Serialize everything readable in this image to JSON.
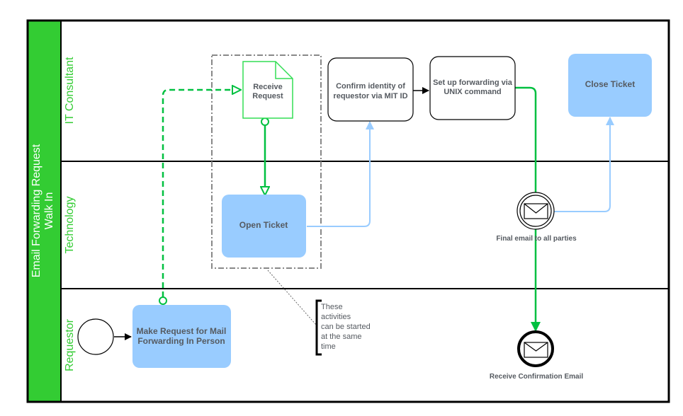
{
  "pool": {
    "title_line1": "Email Forwarding Request",
    "title_line2": "Walk In"
  },
  "lanes": [
    {
      "id": "it-consultant",
      "label": "IT Consultant"
    },
    {
      "id": "technology",
      "label": "Technology"
    },
    {
      "id": "requestor",
      "label": "Requestor"
    }
  ],
  "tasks": {
    "receive_request": {
      "line1": "Receive",
      "line2": "Request",
      "type": "document"
    },
    "confirm_identity": {
      "line1": "Confirm identity of",
      "line2": "requestor via MIT ID"
    },
    "setup_forwarding": {
      "line1": "Set up forwarding via",
      "line2": "UNIX command"
    },
    "close_ticket": {
      "label": "Close Ticket"
    },
    "open_ticket": {
      "label": "Open Ticket"
    },
    "make_request": {
      "line1": "Make Request for Mail",
      "line2": "Forwarding In Person"
    }
  },
  "events": {
    "start": {
      "label": ""
    },
    "final_email": {
      "label": "Final email to all parties",
      "icon": "envelope-icon",
      "type": "intermediate-message"
    },
    "receive_confirmation": {
      "label": "Receive Confirmation Email",
      "icon": "envelope-icon",
      "type": "end-message"
    }
  },
  "annotation": {
    "lines": [
      "These",
      "activities",
      "can be started",
      "at the same",
      "time"
    ]
  },
  "colors": {
    "pool_header": "#33cc33",
    "lane_title": "#33cc33",
    "task_fill_blue": "#99ccff",
    "connector_green": "#00c040",
    "connector_blue": "#99ccff",
    "group_border": "#888888",
    "text_gray": "#555a60"
  }
}
